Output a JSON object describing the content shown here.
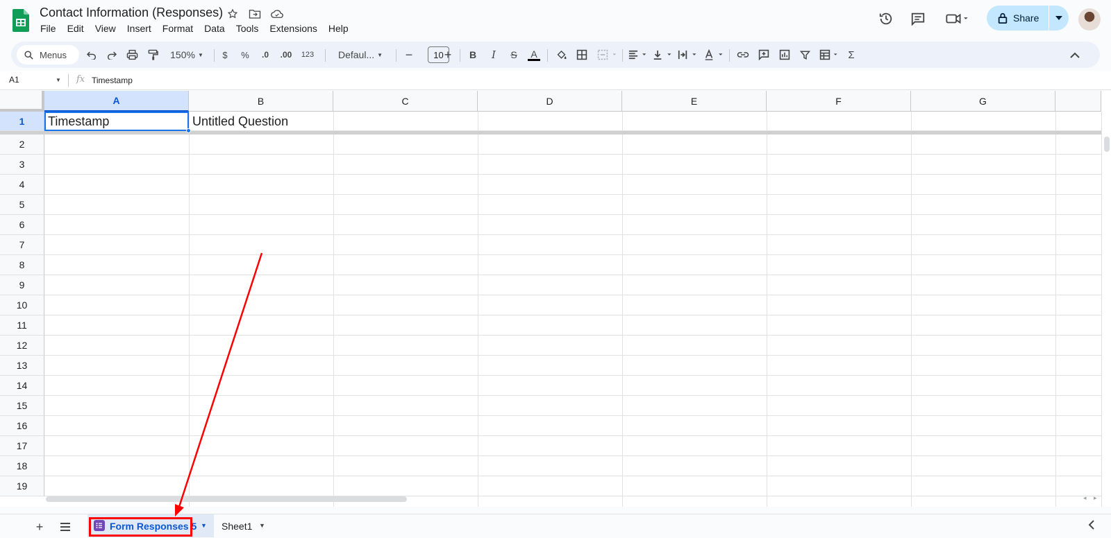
{
  "app": {
    "title": "Contact Information (Responses)",
    "menu": [
      "File",
      "Edit",
      "View",
      "Insert",
      "Format",
      "Data",
      "Tools",
      "Extensions",
      "Help"
    ],
    "share_label": "Share"
  },
  "toolbar": {
    "search_label": "Menus",
    "zoom": "150%",
    "currency": "$",
    "percent": "%",
    "dec_decrease": ".0",
    "dec_increase": ".00",
    "number_format": "123",
    "font": "Defaul...",
    "font_size": "10",
    "bold": "B",
    "italic": "I",
    "strike": "S",
    "text_color": "A",
    "sum": "Σ"
  },
  "formula_bar": {
    "name_box": "A1",
    "fx": "fx",
    "value": "Timestamp"
  },
  "grid": {
    "columns": [
      "A",
      "B",
      "C",
      "D",
      "E",
      "F",
      "G"
    ],
    "rows": [
      "1",
      "2",
      "3",
      "4",
      "5",
      "6",
      "7",
      "8",
      "9",
      "10",
      "11",
      "12",
      "13",
      "14",
      "15",
      "16",
      "17",
      "18",
      "19"
    ],
    "cells": {
      "A1": "Timestamp",
      "B1": "Untitled Question"
    },
    "selected_cell": "A1"
  },
  "sheets": {
    "tabs": [
      {
        "label": "Form Responses 5",
        "active": true
      },
      {
        "label": "Sheet1",
        "active": false
      }
    ]
  },
  "colors": {
    "accent": "#0b57d0",
    "selection": "#1a73e8",
    "share_bg": "#c2e7ff",
    "annotation": "#ff0000",
    "forms_purple": "#7248b9",
    "sheets_green": "#0f9d58"
  }
}
